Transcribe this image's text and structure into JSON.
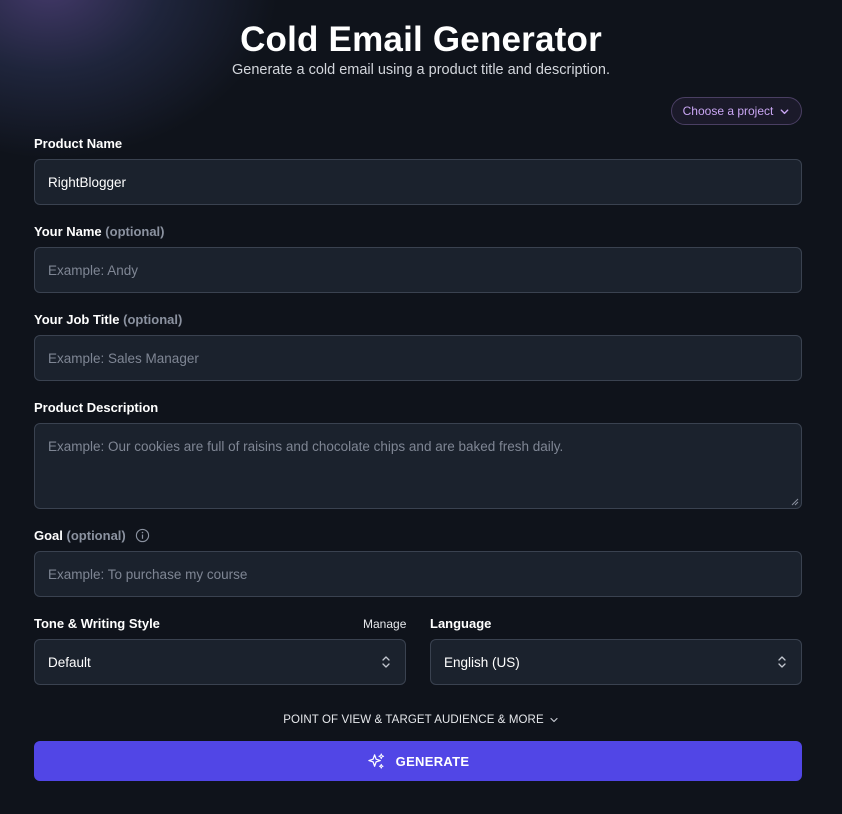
{
  "header": {
    "title": "Cold Email Generator",
    "subtitle": "Generate a cold email using a product title and description."
  },
  "project_selector": {
    "label": "Choose a project",
    "icon": "chevron-down-icon"
  },
  "form": {
    "product_name": {
      "label": "Product Name",
      "value": "RightBlogger"
    },
    "your_name": {
      "label": "Your Name",
      "optional": "(optional)",
      "placeholder": "Example: Andy"
    },
    "job_title": {
      "label": "Your Job Title",
      "optional": "(optional)",
      "placeholder": "Example: Sales Manager"
    },
    "product_description": {
      "label": "Product Description",
      "placeholder": "Example: Our cookies are full of raisins and chocolate chips and are baked fresh daily."
    },
    "goal": {
      "label": "Goal",
      "optional": "(optional)",
      "placeholder": "Example: To purchase my course",
      "icon": "info-icon"
    },
    "tone": {
      "label": "Tone & Writing Style",
      "manage_label": "Manage",
      "selected": "Default"
    },
    "language": {
      "label": "Language",
      "selected": "English (US)"
    }
  },
  "more_options": {
    "label": "POINT OF VIEW & TARGET AUDIENCE & MORE",
    "icon": "chevron-down-icon"
  },
  "generate_button": {
    "label": "GENERATE",
    "icon": "sparkles-icon"
  },
  "colors": {
    "background": "#0f131b",
    "field_bg": "#1b222d",
    "accent": "#5146e6",
    "project_text": "#c9a6f3"
  }
}
